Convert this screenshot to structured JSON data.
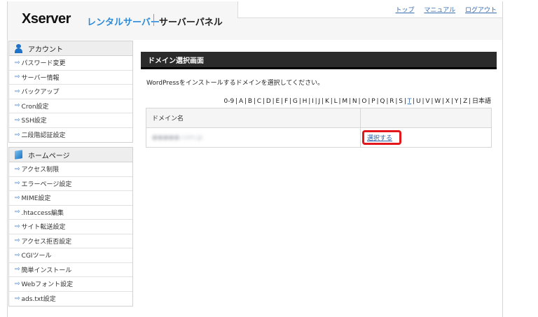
{
  "header": {
    "logo": "Xserver",
    "logo_sub": "レンタルサーバー",
    "panel_title": "サーバーパネル",
    "links": [
      "トップ",
      "マニュアル",
      "ログアウト"
    ]
  },
  "sidebar": {
    "account": {
      "label": "アカウント",
      "items": [
        "パスワード変更",
        "サーバー情報",
        "バックアップ",
        "Cron設定",
        "SSH設定",
        "二段階認証設定"
      ]
    },
    "homepage": {
      "label": "ホームページ",
      "items": [
        "アクセス制限",
        "エラーページ設定",
        "MIME設定",
        ".htaccess編集",
        "サイト転送設定",
        "アクセス拒否設定",
        "CGIツール",
        "簡単インストール",
        "Webフォント設定",
        "ads.txt設定"
      ]
    }
  },
  "main": {
    "title": "ドメイン選択画面",
    "description": "WordPressをインストールするドメインを選択してください。",
    "alphabet": "0-9 | A | B | C | D | E | F | G | H | I | J | K | L | M | N | O | P | Q | R | S |",
    "alphabet_t": "T",
    "alphabet_rest": "| U | V | W | X | Y | Z | 日本語",
    "table_header": "ドメイン名",
    "domain": "●●●●●.com.jp",
    "select_label": "選択する"
  },
  "colors": {
    "accent": "#2e8bd8",
    "title_bar": "#2b2b2b",
    "highlight": "#e2161b"
  }
}
